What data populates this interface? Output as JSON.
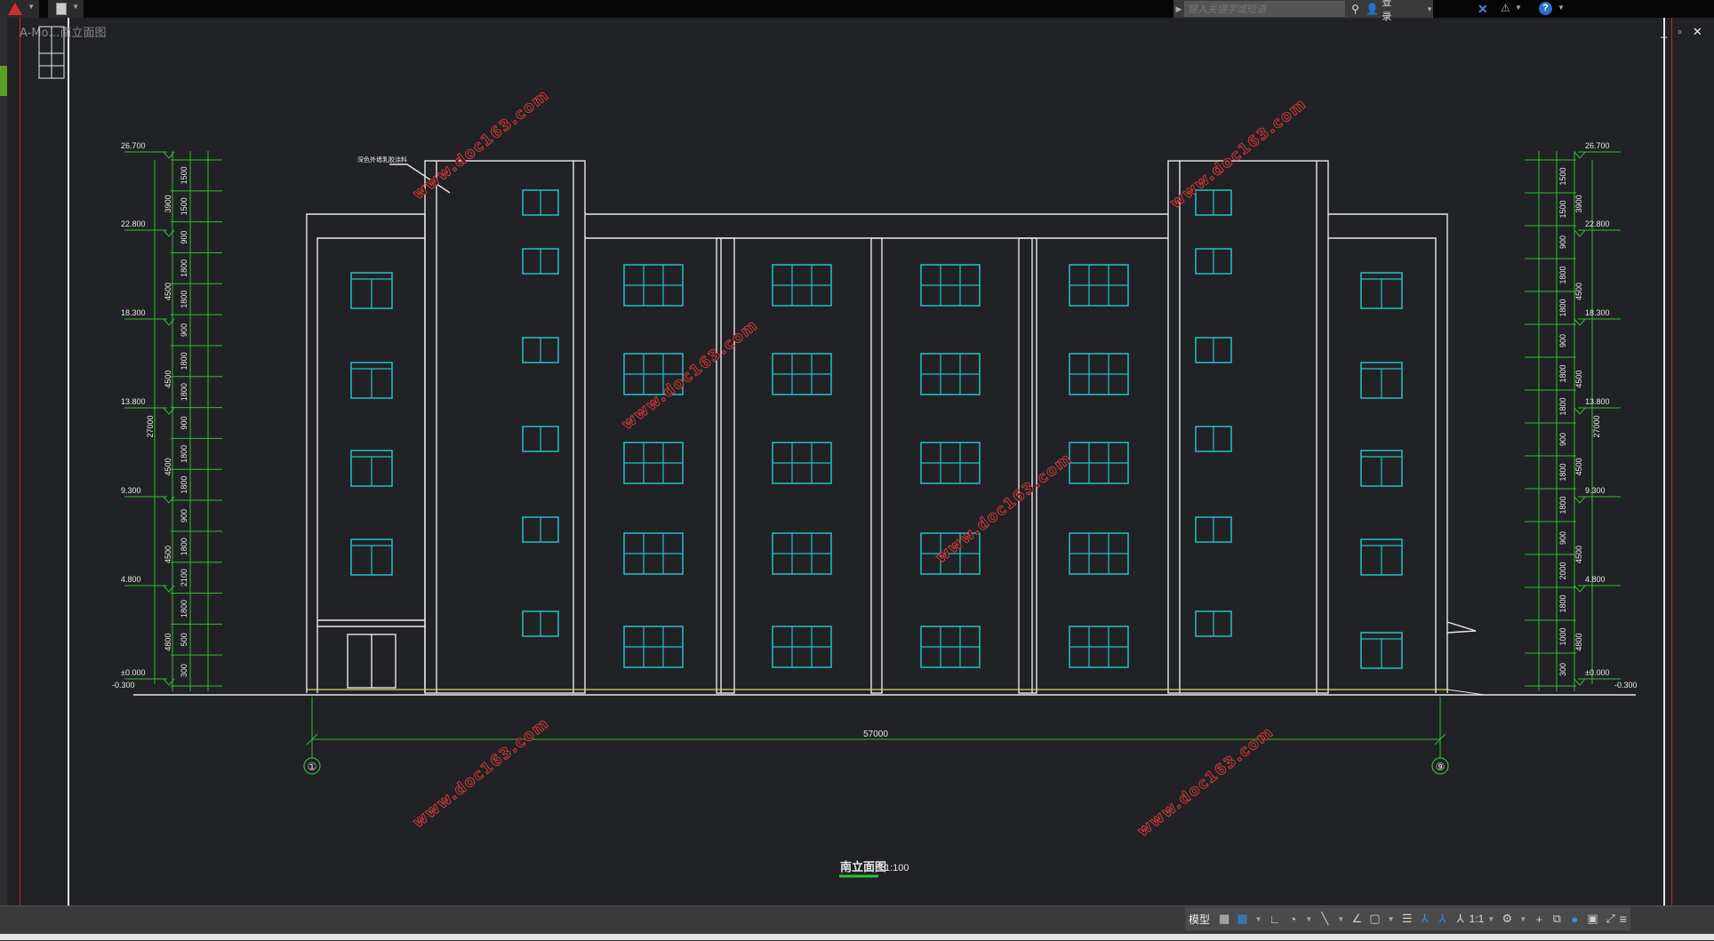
{
  "app": {
    "search_placeholder": "键入关键字或短语",
    "login_label": "登录",
    "drawing_tab": "A-Mo…南立面图"
  },
  "drawing": {
    "title": "南立面图",
    "scale": "1:100",
    "overall_dim": "57000",
    "axis_left": "①",
    "axis_right": "⑨",
    "watermark": "www.doc163.com",
    "callout": "深色外墙乳胶涂料",
    "left_levels": [
      "26.700",
      "22.800",
      "18.300",
      "13.800",
      "9.300",
      "4.800",
      "±0.000",
      "-0.300"
    ],
    "right_levels": [
      "26.700",
      "22.800",
      "18.300",
      "13.800",
      "9.300",
      "4.800",
      "±0.000",
      "-0.300"
    ],
    "left_dims_inner": [
      "1500",
      "1500",
      "900",
      "1800",
      "1800",
      "900",
      "1800",
      "1800",
      "900",
      "1800",
      "1800",
      "900",
      "1800",
      "2100",
      "1800",
      "500",
      "300"
    ],
    "left_dims_outer": [
      "3900",
      "4500",
      "4500",
      "4500",
      "4500",
      "4800"
    ],
    "right_dims_inner": [
      "1500",
      "1500",
      "900",
      "1800",
      "1800",
      "900",
      "1800",
      "1800",
      "900",
      "1800",
      "1800",
      "900",
      "2000",
      "1800",
      "1000",
      "300"
    ],
    "right_dims_outer": [
      "3900",
      "4500",
      "4500",
      "4500",
      "4500",
      "4800"
    ],
    "total_height": "27000"
  },
  "statusbar": {
    "model_label": "模型",
    "scale_label": "1:1"
  },
  "colors": {
    "background": "#212225",
    "line": "#e8e8e8",
    "window": "#22c2c8",
    "dimension": "#2fbf2f",
    "ground": "#d8d86a",
    "watermark": "#e63b3b",
    "accent_blue": "#3a8be0"
  }
}
